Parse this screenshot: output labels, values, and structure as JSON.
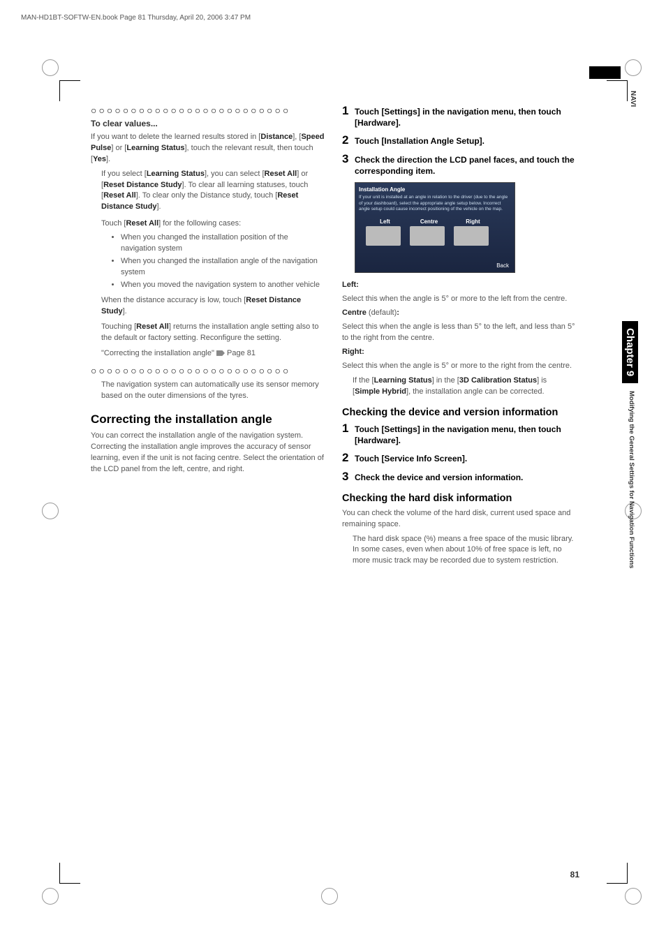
{
  "header_line": "MAN-HD1BT-SOFTW-EN.book  Page 81  Thursday, April 20, 2006  3:47 PM",
  "side": {
    "navi": "NAVI",
    "chapter": "Chapter 9",
    "section": "Modifying the General Settings for Navigation Functions"
  },
  "pagenum": "81",
  "left": {
    "subhead1": "To clear values...",
    "p1a": "If you want to delete the learned results stored in [",
    "p1b": "Distance",
    "p1c": "], [",
    "p1d": "Speed Pulse",
    "p1e": "] or [",
    "p1f": "Learning Status",
    "p1g": "], touch the relevant result, then touch [",
    "p1h": "Yes",
    "p1i": "].",
    "note1a": "If you select [",
    "note1b": "Learning Status",
    "note1c": "], you can select [",
    "note1d": "Reset All",
    "note1e": "] or [",
    "note1f": "Reset Distance Study",
    "note1g": "]. To clear all learning statuses, touch [",
    "note1h": "Reset All",
    "note1i": "]. To clear only the Distance study, touch [",
    "note1j": "Reset Distance Study",
    "note1k": "].",
    "note2a": "Touch [",
    "note2b": "Reset All",
    "note2c": "] for the following cases:",
    "li1": "When you changed the installation position of the navigation system",
    "li2": "When you changed the installation angle of the navigation system",
    "li3": "When you moved the navigation system to another vehicle",
    "note3a": "When the distance accuracy is low, touch [",
    "note3b": "Reset Distance Study",
    "note3c": "].",
    "note4a": "Touching [",
    "note4b": "Reset All",
    "note4c": "] returns the installation angle setting also to the default or factory setting. Reconfigure the setting.",
    "ref1": "\"Correcting the installation angle\" ",
    "ref1p": " Page 81",
    "note5": "The navigation system can automatically use its sensor memory based on the outer dimensions of the tyres.",
    "h1_1": "Correcting the installation angle",
    "p2": "You can correct the installation angle of the navigation system. Correcting the installation angle improves the accuracy of sensor learning, even if the unit is not facing centre. Select the orientation of the LCD panel from the left, centre, and right."
  },
  "right": {
    "step1": "Touch [Settings] in the navigation menu, then touch [Hardware].",
    "step2": "Touch [Installation Angle Setup].",
    "step3": "Check the direction the LCD panel faces, and touch the corresponding item.",
    "shot": {
      "title": "Installation Angle",
      "desc": "If your unit is installed at an angle in relation to the driver (due to the angle of your dashboard), select the appropriate angle setup below. Incorrect angle setup could cause incorrect positioning of the vehicle on the map.",
      "opt1": "Left",
      "opt2": "Centre",
      "opt3": "Right",
      "back": "Back"
    },
    "left_h": "Left:",
    "left_p": "Select this when the angle is 5° or more to the left from the centre.",
    "centre_h1": "Centre",
    "centre_h2": " (default)",
    "centre_h3": ":",
    "centre_p": "Select this when the angle is less than 5° to the left, and less than 5° to the right from the centre.",
    "right_h": "Right:",
    "right_p": "Select this when the angle is 5° or more to the right from the centre.",
    "note6a": "If the [",
    "note6b": "Learning Status",
    "note6c": "] in the [",
    "note6d": "3D Calibration Status",
    "note6e": "] is [",
    "note6f": "Simple Hybrid",
    "note6g": "], the installation angle can be corrected.",
    "h2_1": "Checking the device and version information",
    "b_step1": "Touch [Settings] in the navigation menu, then touch [Hardware].",
    "b_step2": "Touch [Service Info Screen].",
    "b_step3": "Check the device and version information.",
    "h2_2": "Checking the hard disk information",
    "p3": "You can check the volume of the hard disk, current used space and remaining space.",
    "note7": "The hard disk space (%) means a free space of the music library. In some cases, even when about 10% of free space is left, no more music track may be recorded due to system restriction."
  }
}
